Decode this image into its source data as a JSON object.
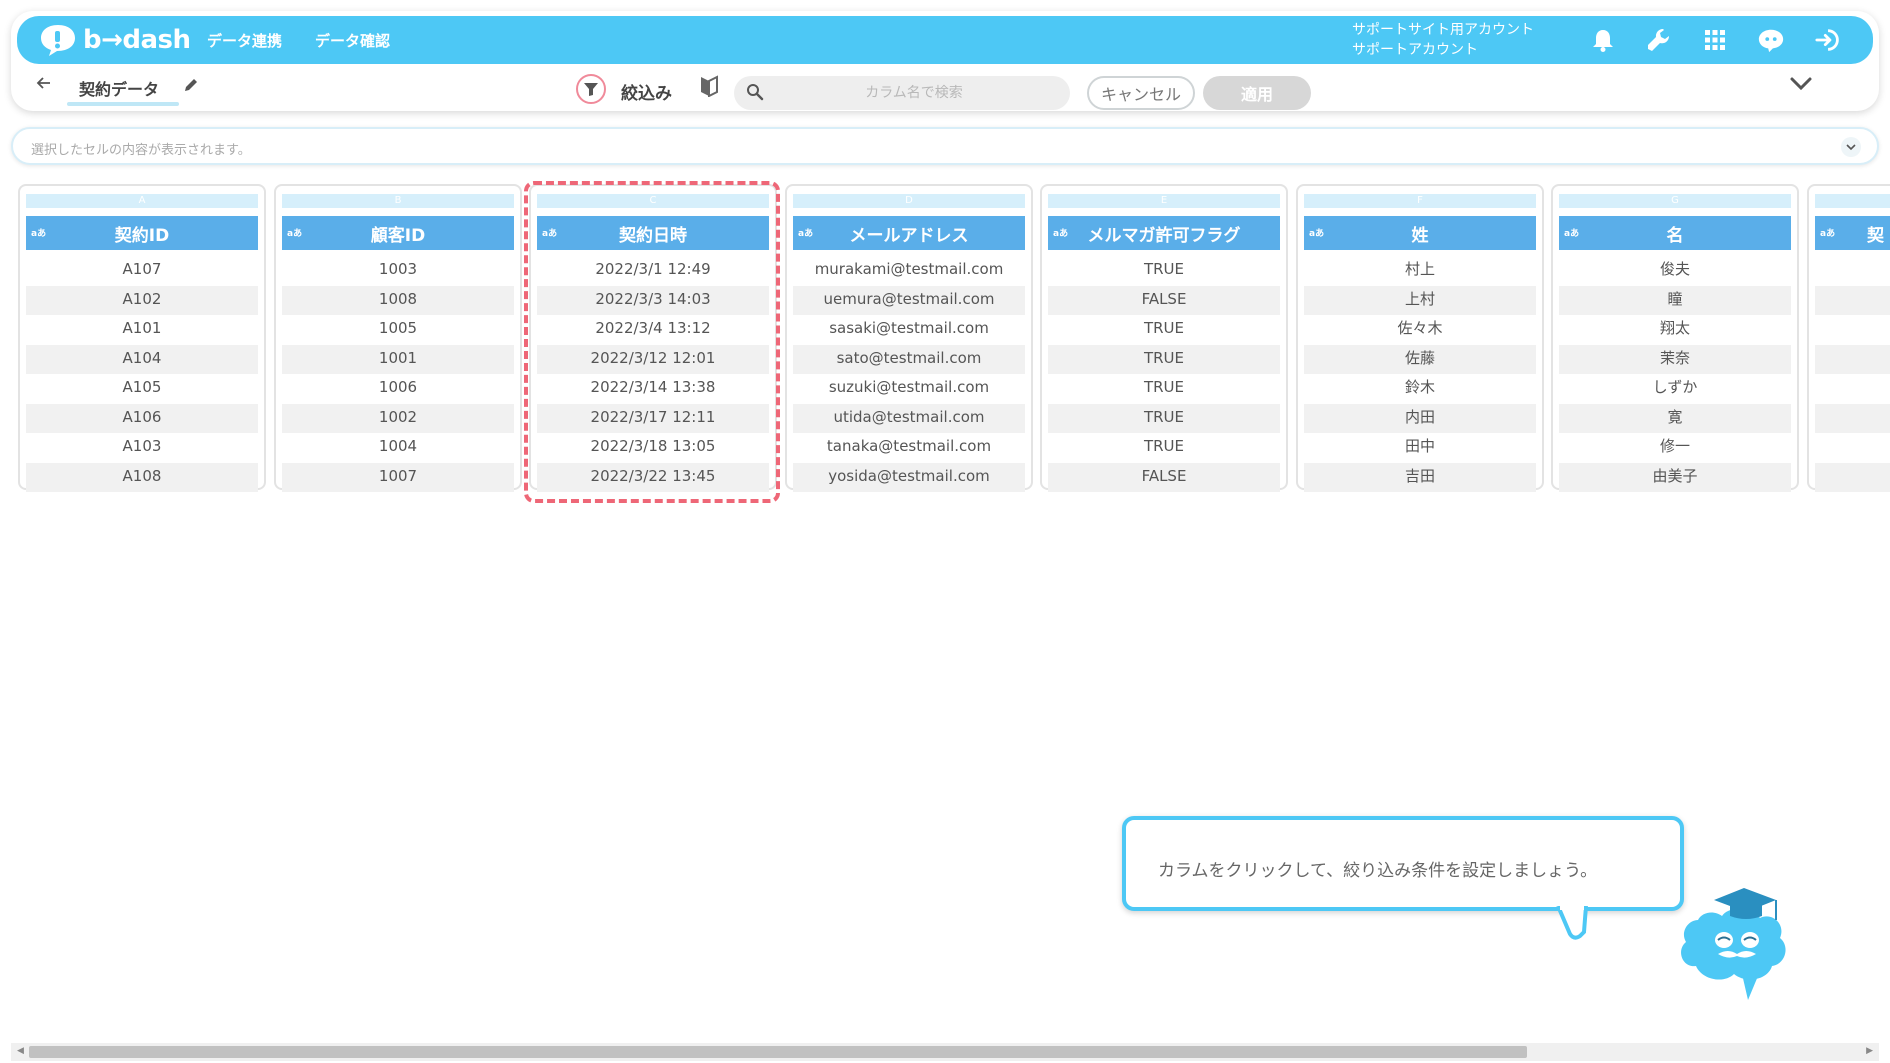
{
  "header": {
    "logo_text": "b→dash",
    "nav": [
      "データ連携",
      "データ確認"
    ],
    "account_line1": "サポートサイト用アカウント",
    "account_line2": "サポートアカウント"
  },
  "toolbar": {
    "title": "契約データ",
    "filter_label": "絞込み",
    "search_placeholder": "カラム名で検索",
    "cancel_label": "キャンセル",
    "apply_label": "適用"
  },
  "cell_bar": {
    "placeholder": "選択したセルの内容が表示されます。"
  },
  "columns": [
    {
      "letter": "A",
      "type": "aあ",
      "name": "契約ID",
      "cells": [
        "A107",
        "A102",
        "A101",
        "A104",
        "A105",
        "A106",
        "A103",
        "A108"
      ]
    },
    {
      "letter": "B",
      "type": "aあ",
      "name": "顧客ID",
      "cells": [
        "1003",
        "1008",
        "1005",
        "1001",
        "1006",
        "1002",
        "1004",
        "1007"
      ]
    },
    {
      "letter": "C",
      "type": "aあ",
      "name": "契約日時",
      "cells": [
        "2022/3/1 12:49",
        "2022/3/3 14:03",
        "2022/3/4 13:12",
        "2022/3/12 12:01",
        "2022/3/14 13:38",
        "2022/3/17 12:11",
        "2022/3/18 13:05",
        "2022/3/22 13:45"
      ]
    },
    {
      "letter": "D",
      "type": "aあ",
      "name": "メールアドレス",
      "cells": [
        "murakami@testmail.com",
        "uemura@testmail.com",
        "sasaki@testmail.com",
        "sato@testmail.com",
        "suzuki@testmail.com",
        "utida@testmail.com",
        "tanaka@testmail.com",
        "yosida@testmail.com"
      ]
    },
    {
      "letter": "E",
      "type": "aあ",
      "name": "メルマガ許可フラグ",
      "cells": [
        "TRUE",
        "FALSE",
        "TRUE",
        "TRUE",
        "TRUE",
        "TRUE",
        "TRUE",
        "FALSE"
      ]
    },
    {
      "letter": "F",
      "type": "aあ",
      "name": "姓",
      "cells": [
        "村上",
        "上村",
        "佐々木",
        "佐藤",
        "鈴木",
        "内田",
        "田中",
        "吉田"
      ]
    },
    {
      "letter": "G",
      "type": "aあ",
      "name": "名",
      "cells": [
        "俊夫",
        "瞳",
        "翔太",
        "茉奈",
        "しずか",
        "寛",
        "修一",
        "由美子"
      ]
    },
    {
      "letter": "",
      "type": "aあ",
      "name": "契",
      "cells": [
        "",
        "",
        "",
        "",
        "",
        "",
        "",
        ""
      ]
    }
  ],
  "tooltip": {
    "text": "カラムをクリックして、絞り込み条件を設定しましょう。"
  },
  "colors": {
    "brand": "#4dc8f5",
    "header_blue": "#5aaee9",
    "selection": "#ee6777"
  },
  "icons": [
    "logo-bubble-icon",
    "bell-icon",
    "wrench-icon",
    "grid-icon",
    "chat-icon",
    "logout-icon",
    "back-arrow-icon",
    "pencil-icon",
    "filter-icon",
    "beginner-mark-icon",
    "search-icon",
    "chevron-down-icon",
    "mascot-icon"
  ]
}
